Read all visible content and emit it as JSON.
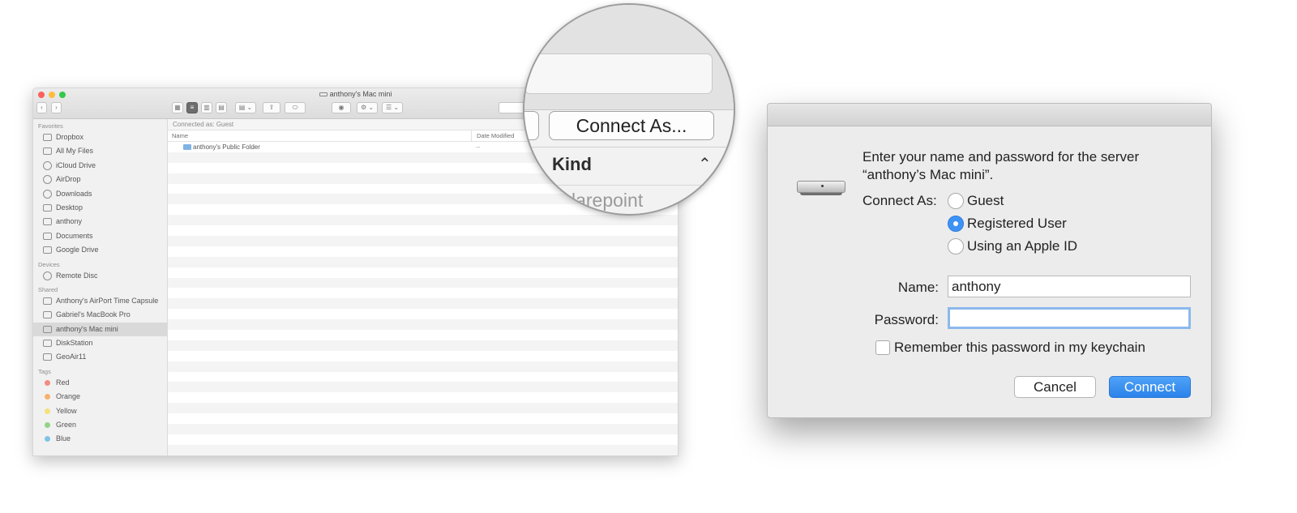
{
  "finder": {
    "title": "anthony's Mac mini",
    "connected_as": "Connected as: Guest",
    "columns": {
      "name": "Name",
      "date_modified": "Date Modified"
    },
    "files": [
      {
        "name": "anthony's Public Folder",
        "date": "--"
      }
    ],
    "sidebar": {
      "favorites_title": "Favorites",
      "favorites": [
        "Dropbox",
        "All My Files",
        "iCloud Drive",
        "AirDrop",
        "Downloads",
        "Desktop",
        "anthony",
        "Documents",
        "Google Drive"
      ],
      "devices_title": "Devices",
      "devices": [
        "Remote Disc"
      ],
      "shared_title": "Shared",
      "shared": [
        "Anthony's AirPort Time Capsule",
        "Gabriel's MacBook Pro",
        "anthony's Mac mini",
        "DiskStation",
        "GeoAir11"
      ],
      "tags_title": "Tags",
      "tags": [
        {
          "label": "Red",
          "color": "#f28b82"
        },
        {
          "label": "Orange",
          "color": "#f6b26b"
        },
        {
          "label": "Yellow",
          "color": "#f3e27a"
        },
        {
          "label": "Green",
          "color": "#93d486"
        },
        {
          "label": "Blue",
          "color": "#7ec3e8"
        }
      ]
    }
  },
  "magnifier": {
    "connect_as_button": "Connect As...",
    "kind_label": "Kind",
    "partial_text": "larepoint"
  },
  "dialog": {
    "message_line1": "Enter your name and password for the server",
    "message_line2": "“anthony’s Mac mini”.",
    "connect_as_label": "Connect As:",
    "options": [
      "Guest",
      "Registered User",
      "Using an Apple ID"
    ],
    "selected_option": "Registered User",
    "name_label": "Name:",
    "name_value": "anthony",
    "password_label": "Password:",
    "password_value": "",
    "remember_label": "Remember this password in my keychain",
    "cancel_label": "Cancel",
    "connect_label": "Connect",
    "accent_color": "#3d92f5"
  }
}
